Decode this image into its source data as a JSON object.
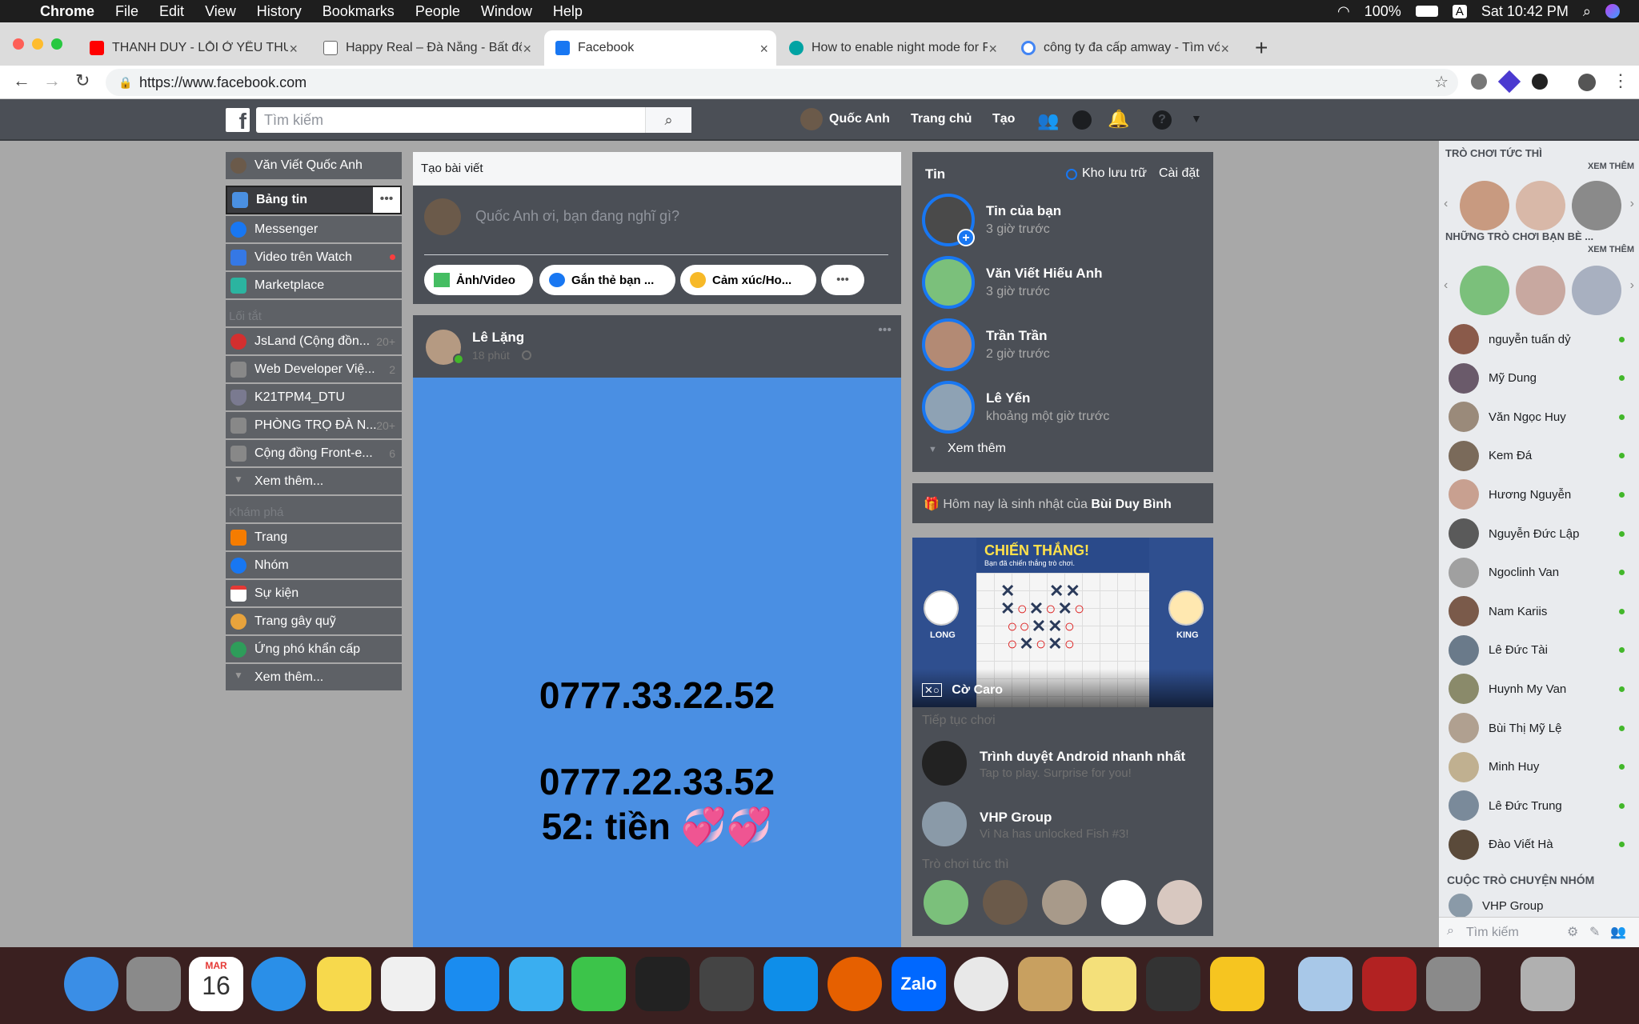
{
  "menubar": {
    "app": "Chrome",
    "items": [
      "File",
      "Edit",
      "View",
      "History",
      "Bookmarks",
      "People",
      "Window",
      "Help"
    ],
    "battery": "100%",
    "input": "A",
    "clock": "Sat 10:42 PM"
  },
  "tabs": [
    {
      "title": "THANH DUY - LỖI Ở YÊU THƯƠNG",
      "color": "#ff0000"
    },
    {
      "title": "Happy Real – Đà Nẵng - Bất động sản",
      "color": "#999999"
    },
    {
      "title": "Facebook",
      "color": "#1877f2"
    },
    {
      "title": "How to enable night mode for Facebook",
      "color": "#00a3a3"
    },
    {
      "title": "công ty đa cấp amway - Tìm với Google",
      "color": "#4285f4"
    }
  ],
  "url": "https://www.facebook.com",
  "header": {
    "search_placeholder": "Tìm kiếm",
    "user": "Quốc Anh",
    "home": "Trang chủ",
    "create": "Tạo"
  },
  "left": {
    "profile": "Văn Viết Quốc Anh",
    "main": [
      {
        "label": "Bảng tin",
        "icon": "news-feed-icon"
      },
      {
        "label": "Messenger",
        "icon": "messenger-icon"
      },
      {
        "label": "Video trên Watch",
        "icon": "watch-icon"
      },
      {
        "label": "Marketplace",
        "icon": "marketplace-icon"
      }
    ],
    "shortcuts_title": "Lối tắt",
    "shortcuts": [
      {
        "label": "JsLand (Cộng đồn...",
        "count": "20+"
      },
      {
        "label": "Web Developer Việ...",
        "count": "2"
      },
      {
        "label": "K21TPM4_DTU",
        "count": ""
      },
      {
        "label": "PHÒNG TRỌ ĐÀ N...",
        "count": "20+"
      },
      {
        "label": "Cộng đồng Front-e...",
        "count": "6"
      }
    ],
    "more1": "Xem thêm...",
    "explore_title": "Khám phá",
    "explore": [
      {
        "label": "Trang"
      },
      {
        "label": "Nhóm"
      },
      {
        "label": "Sự kiện"
      },
      {
        "label": "Trang gây quỹ"
      },
      {
        "label": "Ứng phó khẩn cấp"
      }
    ],
    "more2": "Xem thêm..."
  },
  "composer": {
    "title": "Tạo bài viết",
    "placeholder": "Quốc Anh ơi, bạn đang nghĩ gì?",
    "actions": [
      "Ảnh/Video",
      "Gắn thẻ bạn ...",
      "Cảm xúc/Ho...",
      "•••"
    ]
  },
  "post": {
    "author": "Lê Lặng",
    "time": "18 phút",
    "line1": "0777.33.22.52",
    "line2": "0777.22.33.52",
    "line3": "52: tiền 💞💞"
  },
  "stories": {
    "title": "Tin",
    "archive": "Kho lưu trữ",
    "settings": "Cài đặt",
    "items": [
      {
        "name": "Tin của bạn",
        "time": "3 giờ trước"
      },
      {
        "name": "Văn Viết Hiếu Anh",
        "time": "3 giờ trước"
      },
      {
        "name": "Trần Trần",
        "time": "2 giờ trước"
      },
      {
        "name": "Lê Yến",
        "time": "khoảng một giờ trước"
      }
    ],
    "more": "Xem thêm"
  },
  "birthday": {
    "prefix": "Hôm nay là sinh nhật của",
    "name": "Bùi Duy Bình"
  },
  "game": {
    "banner": "CHIẾN THẮNG!",
    "sub": "Bạn đã chiến thắng trò chơi.",
    "p1": "LONG",
    "p2": "KING",
    "name": "Cờ Caro",
    "continue": "Tiếp tục chơi",
    "g1": "Trình duyệt Android nhanh nhất",
    "g1s": "Tap to play. Surprise for you!",
    "g2": "VHP Group",
    "g2s": "Vi Na has unlocked Fish #3!",
    "instant": "Trò chơi tức thì"
  },
  "chat": {
    "games_title": "TRÒ CHƠI TỨC THÌ",
    "see_more": "XEM THÊM",
    "friends_games": "NHỮNG TRÒ CHƠI BẠN BÈ ...",
    "contacts": [
      "nguyễn tuấn dỷ",
      "Mỹ Dung",
      "Văn Ngọc Huy",
      "Kem Đá",
      "Hương Nguyễn",
      "Nguyễn Đức Lập",
      "Ngoclinh Van",
      "Nam Kariis",
      "Lê Đức Tài",
      "Huynh My Van",
      "Bùi Thị Mỹ Lệ",
      "Minh Huy",
      "Lê Đức Trung",
      "Đào Viết Hà"
    ],
    "group_title": "CUỘC TRÒ CHUYỆN NHÓM",
    "group": "VHP Group",
    "search": "Tìm kiếm"
  },
  "dock": {
    "calendar_month": "MAR",
    "calendar_day": "16",
    "apps": [
      "finder-icon",
      "launchpad-icon",
      "calendar-icon",
      "safari-icon",
      "notes-icon",
      "photos-icon",
      "app-store-icon",
      "messages-icon",
      "facetime-icon",
      "terminal-icon",
      "sublime-icon",
      "teamviewer-icon",
      "firefox-icon",
      "zalo-icon",
      "chrome-icon",
      "paintbrush-icon",
      "stickies-icon",
      "pixelmator-icon",
      "cyberduck-icon",
      "preview-icon",
      "photo-booth-icon",
      "system-preferences-icon",
      "trash-icon"
    ],
    "zalo": "Zalo"
  }
}
